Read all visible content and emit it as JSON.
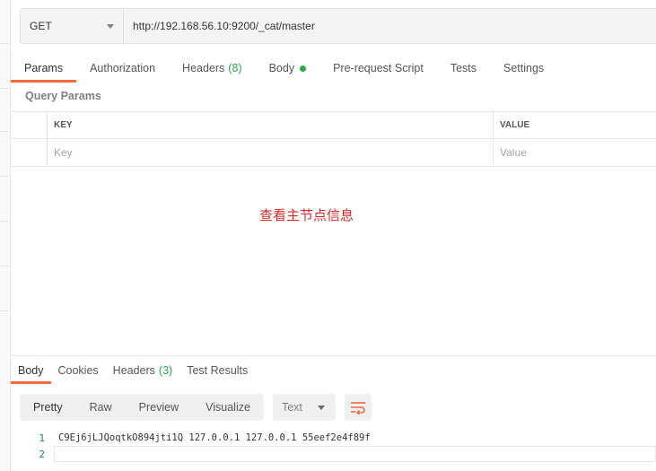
{
  "request": {
    "method": "GET",
    "url": "http://192.168.56.10:9200/_cat/master"
  },
  "request_tabs": [
    {
      "label": "Params",
      "active": true
    },
    {
      "label": "Authorization"
    },
    {
      "label": "Headers",
      "count": "(8)"
    },
    {
      "label": "Body",
      "indicator": "green-dot"
    },
    {
      "label": "Pre-request Script"
    },
    {
      "label": "Tests"
    },
    {
      "label": "Settings"
    }
  ],
  "query_params": {
    "title": "Query Params",
    "columns": [
      "KEY",
      "VALUE"
    ],
    "placeholders": {
      "key": "Key",
      "value": "Value"
    }
  },
  "annotation": "查看主节点信息",
  "response_tabs": [
    {
      "label": "Body",
      "active": true
    },
    {
      "label": "Cookies"
    },
    {
      "label": "Headers",
      "count": "(3)"
    },
    {
      "label": "Test Results"
    }
  ],
  "view_modes": [
    "Pretty",
    "Raw",
    "Preview",
    "Visualize"
  ],
  "format_select": "Text",
  "wrap_icon": "wrap-lines-icon",
  "response_body": [
    {
      "line": "1",
      "text": "C9Ej6jLJQoqtkO894jti1Q 127.0.0.1 127.0.0.1 55eef2e4f89f"
    },
    {
      "line": "2",
      "text": ""
    }
  ],
  "colors": {
    "accent": "#f26b3a",
    "count_green": "#27a844",
    "annotation_red": "#e0262b"
  }
}
